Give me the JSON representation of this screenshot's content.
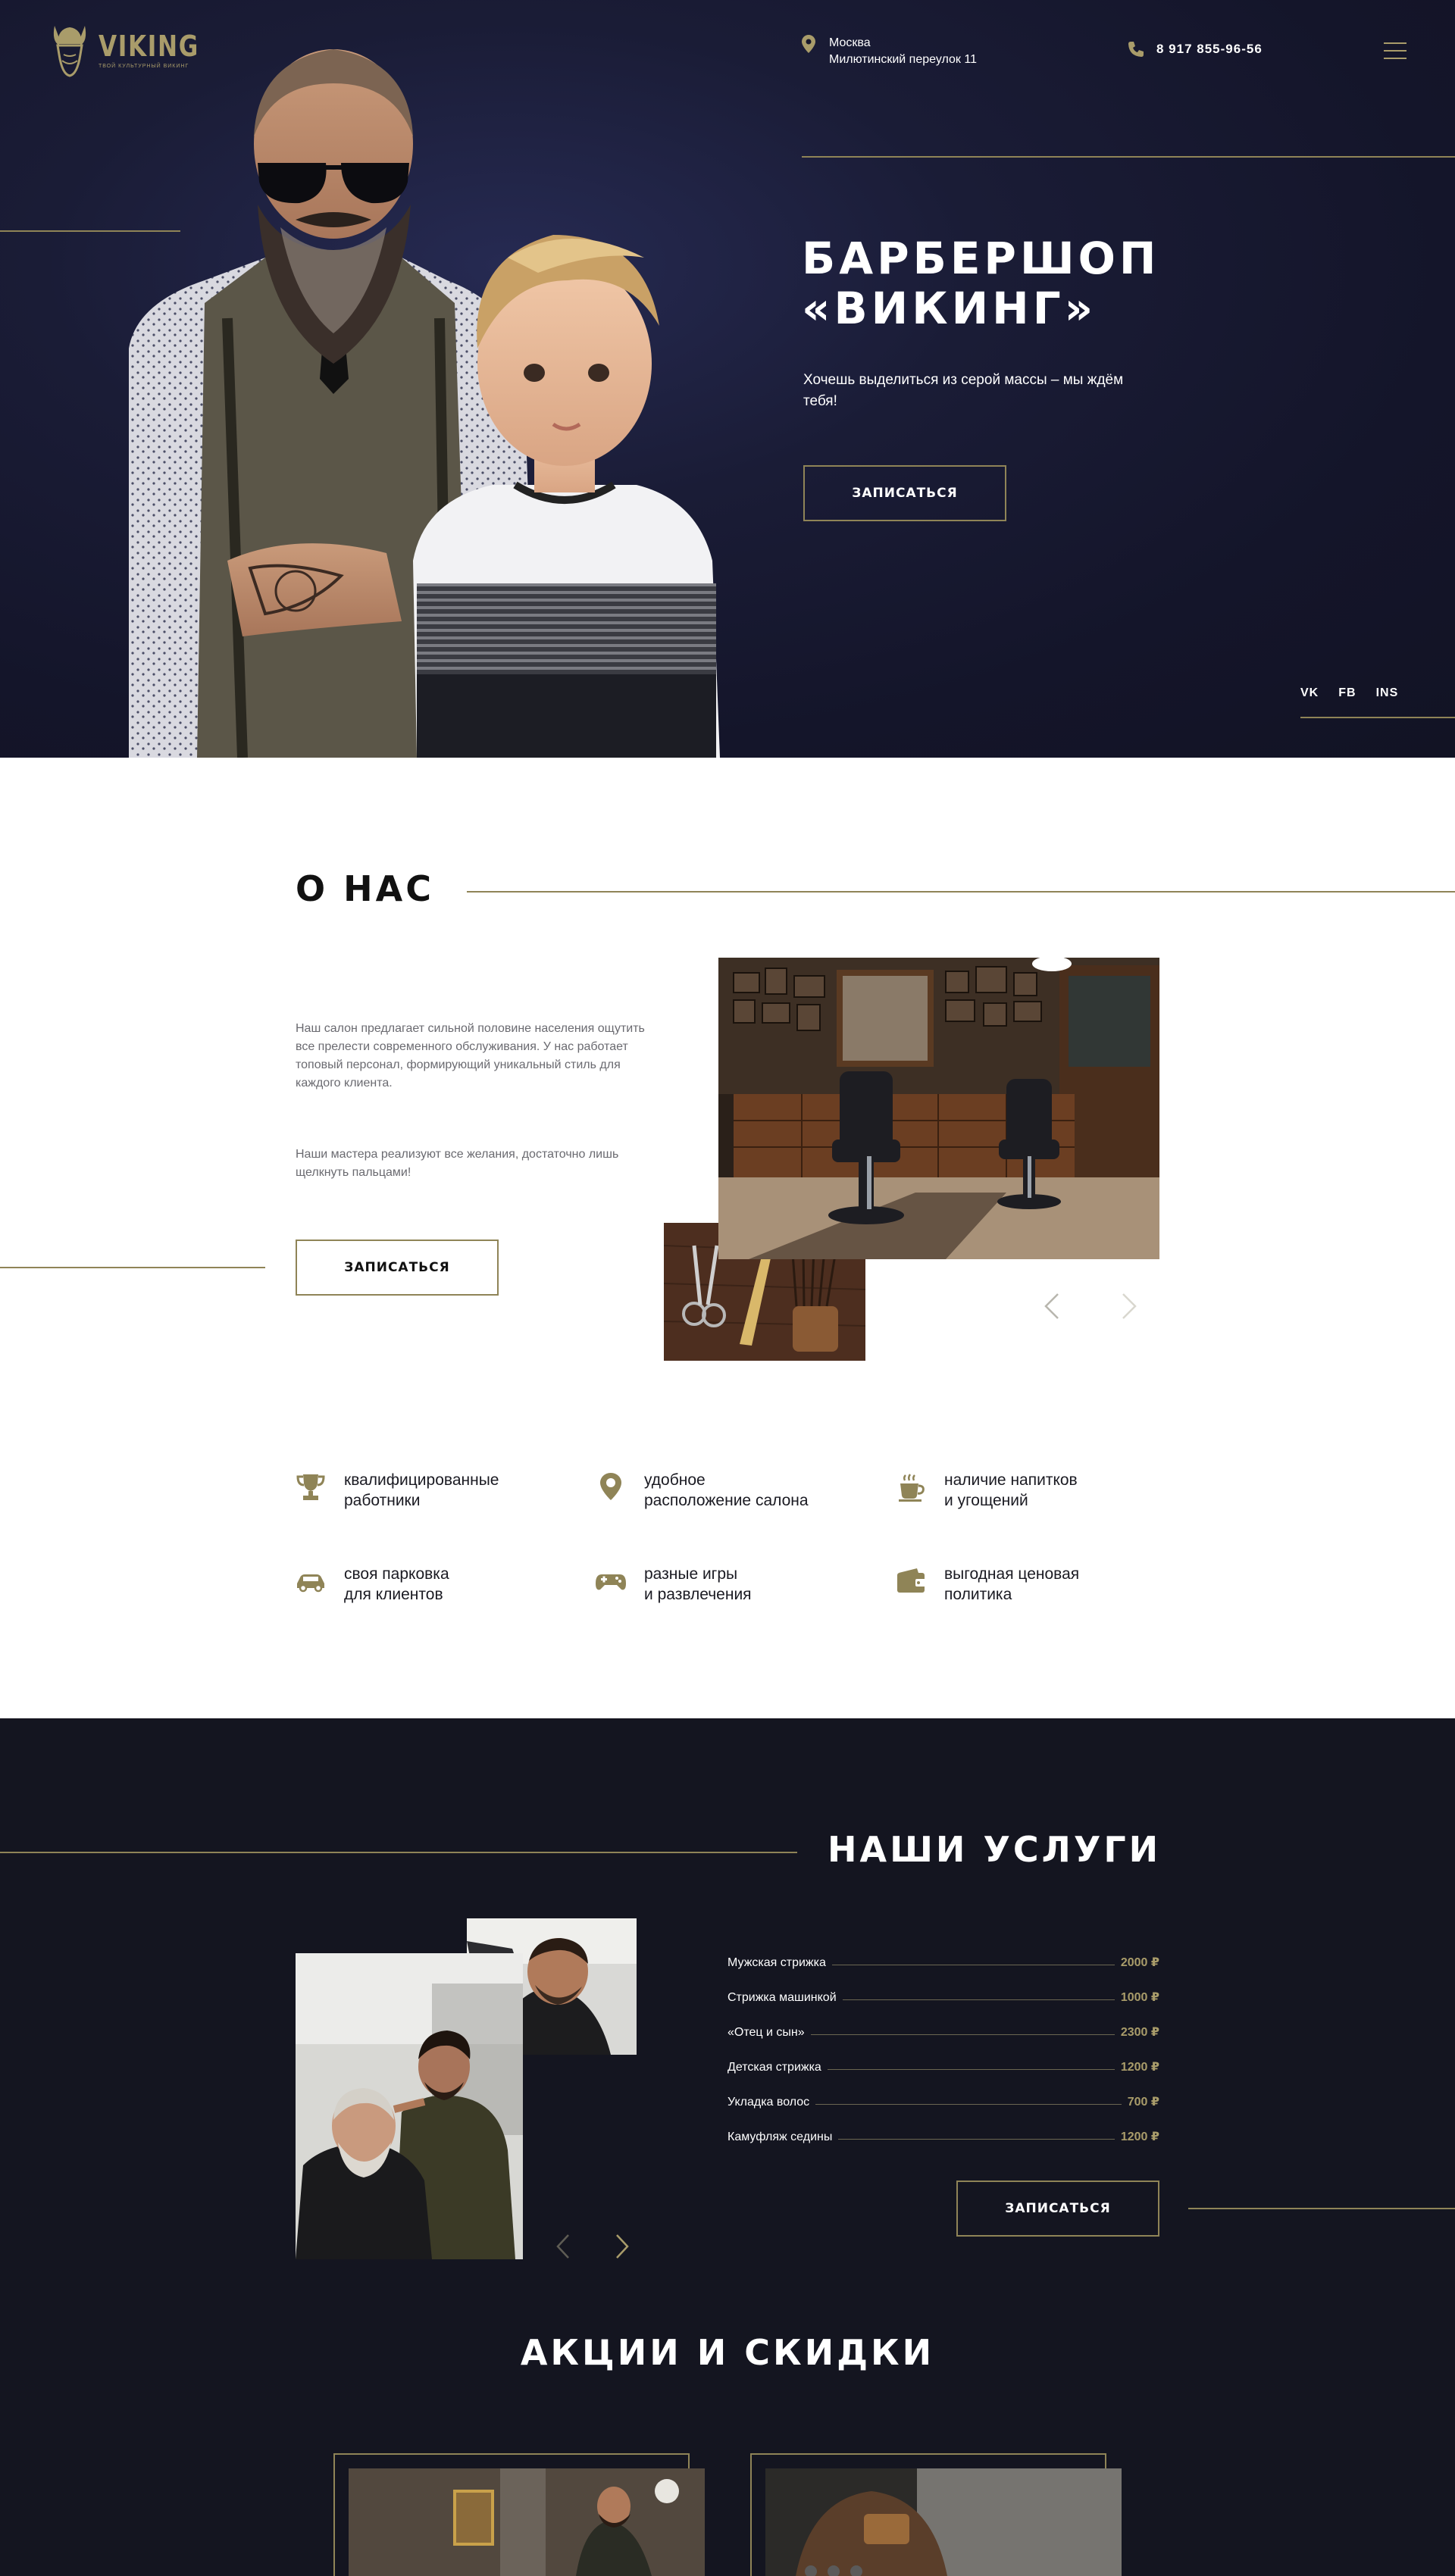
{
  "header": {
    "logo_name": "VIKING",
    "logo_tagline": "ТВОЙ КУЛЬТУРНЫЙ ВИКИНГ",
    "city": "Москва",
    "street": "Милютинский переулок 11",
    "phone": "8 917 855-96-56"
  },
  "hero": {
    "title_line1": "БАРБЕРШОП",
    "title_line2": "«ВИКИНГ»",
    "subtitle": "Хочешь выделиться из серой массы – мы ждём тебя!",
    "cta": "ЗАПИСАТЬСЯ",
    "socials": [
      "VK",
      "FB",
      "INS"
    ]
  },
  "about": {
    "title": "О НАС",
    "paragraph1": "Наш салон предлагает сильной половине населения ощутить все прелести современного обслуживания. У нас работает топовый персонал, формирующий уникальный стиль для каждого клиента.",
    "paragraph2": "Наши мастера реализуют все желания, достаточно лишь щелкнуть пальцами!",
    "cta": "ЗАПИСАТЬСЯ",
    "features": [
      {
        "icon": "trophy-icon",
        "label": "квалифицированные\nработники"
      },
      {
        "icon": "location-pin-icon",
        "label": "удобное\nрасположение салона"
      },
      {
        "icon": "coffee-cup-icon",
        "label": "наличие напитков\nи угощений"
      },
      {
        "icon": "car-icon",
        "label": "своя парковка\nдля клиентов"
      },
      {
        "icon": "gamepad-icon",
        "label": "разные игры\nи развлечения"
      },
      {
        "icon": "wallet-icon",
        "label": "выгодная ценовая\nполитика"
      }
    ]
  },
  "services": {
    "title": "НАШИ УСЛУГИ",
    "prices": [
      {
        "name": "Мужская стрижка",
        "price": "2000 ₽"
      },
      {
        "name": "Стрижка машинкой",
        "price": "1000 ₽"
      },
      {
        "name": "«Отец и сын»",
        "price": "2300 ₽"
      },
      {
        "name": "Детская стрижка",
        "price": "1200 ₽"
      },
      {
        "name": "Укладка волос",
        "price": "700 ₽"
      },
      {
        "name": "Камуфляж седины",
        "price": "1200 ₽"
      }
    ],
    "cta": "ЗАПИСАТЬСЯ"
  },
  "promo": {
    "title": "АКЦИИ И СКИДКИ"
  },
  "colors": {
    "accent_gold": "#a99c6a",
    "dark_bg": "#141520",
    "hero_bg": "#1a1c36"
  }
}
